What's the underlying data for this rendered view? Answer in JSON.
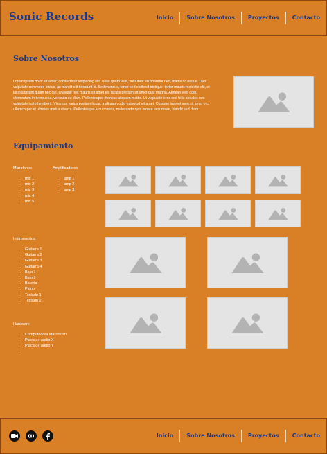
{
  "header": {
    "brand": "Sonic Records",
    "nav": [
      "Inicio",
      "Sobre Nosotros",
      "Proyectos",
      "Contacto"
    ]
  },
  "about": {
    "title": "Sobre Nosotros",
    "text": "Lorem ipsum dolor sit amet, consectetur adipiscing elit. Nulla quam velit, vulputate eu pharetra nec, mattis ac neque. Duis vulputate commodo lectus, ac blandit elit tincidunt id. Sed rhoncus, tortor sed eleifend tristique, tortor mauris molestie elit, et lacinia ipsum quam nec dui. Quisque nec mauris sit amet elit iaculis pretium sit amet quis magna. Aenean velit odio, elementum in tempus ut, vehicula eu diam. Pellentesque rhoncus aliquam mattis. Ut vulputate eros sed felis sodales nec vulputate justo hendrerit. Vivamus varius pretium ligula, a aliquam odio euismod sit amet. Quisque laoreet sem sit amet orci ullamcorper et ultricies metus viverra. Pellentesque arcu mauris, malesuada quis ornare accumsan, blandit sed diam."
  },
  "equipment": {
    "title": "Equipamiento",
    "microfonos": {
      "title": "Microfonos",
      "items": [
        "mic 1",
        "mic 2",
        "mic 3",
        "mic 4",
        "mic 5"
      ]
    },
    "amplificadores": {
      "title": "Amplificadores",
      "items": [
        "amp 1",
        "amp 2",
        "amp 3"
      ]
    },
    "instrumentos": {
      "title": "Instrumentos:",
      "items": [
        "Guitarra 1",
        "Guitarra 2",
        "Guitarra 3",
        "Guitarra 4",
        "Bajo 1",
        "Bajo 2",
        "Bateria",
        "Piano",
        "Teclado 1",
        "Teclado 2"
      ]
    },
    "hardware": {
      "title": "Hardware",
      "items": [
        "Computadora Macintosh",
        "Placa de audio X",
        "Placa de audio Y",
        ""
      ]
    }
  },
  "footer": {
    "social_icons": [
      "video-camera-icon",
      "podcast-icon",
      "facebook-icon"
    ],
    "nav": [
      "Inicio",
      "Sobre Nosotros",
      "Proyectos",
      "Contacto"
    ]
  },
  "colors": {
    "background": "#d97f25",
    "accent": "#1e3a8a",
    "placeholder": "#e4e4e4"
  }
}
